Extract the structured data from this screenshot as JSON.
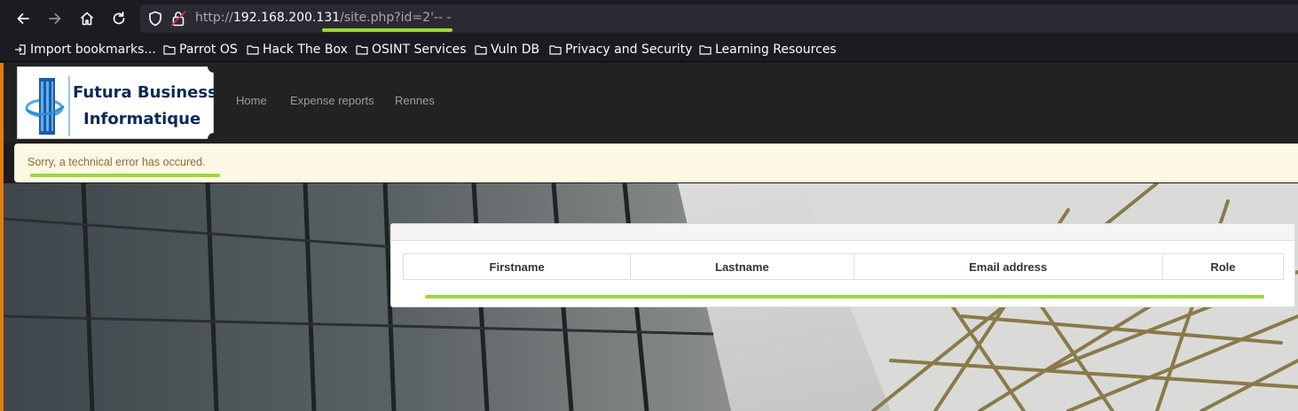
{
  "browser": {
    "url_prefix": "http://",
    "url_host": "192.168.200.131",
    "url_path": "/site.php?id=2'-- -",
    "bookmarks": [
      {
        "label": "Import bookmarks...",
        "icon": "import-icon"
      },
      {
        "label": "Parrot OS",
        "icon": "folder-icon"
      },
      {
        "label": "Hack The Box",
        "icon": "folder-icon"
      },
      {
        "label": "OSINT Services",
        "icon": "folder-icon"
      },
      {
        "label": "Vuln DB",
        "icon": "folder-icon"
      },
      {
        "label": "Privacy and Security",
        "icon": "folder-icon"
      },
      {
        "label": "Learning Resources",
        "icon": "folder-icon"
      }
    ]
  },
  "site": {
    "logo_line1": "Futura Business",
    "logo_line2": "Informatique",
    "nav": [
      "Home",
      "Expense reports",
      "Rennes"
    ]
  },
  "alert": {
    "message": "Sorry, a technical error has occured."
  },
  "table": {
    "headers": [
      "Firstname",
      "Lastname",
      "Email address",
      "Role"
    ]
  },
  "colors": {
    "highlight": "#9bd83a",
    "alert_bg": "#fcf8e3",
    "alert_text": "#8a6d3b",
    "navbar": "#222222"
  }
}
